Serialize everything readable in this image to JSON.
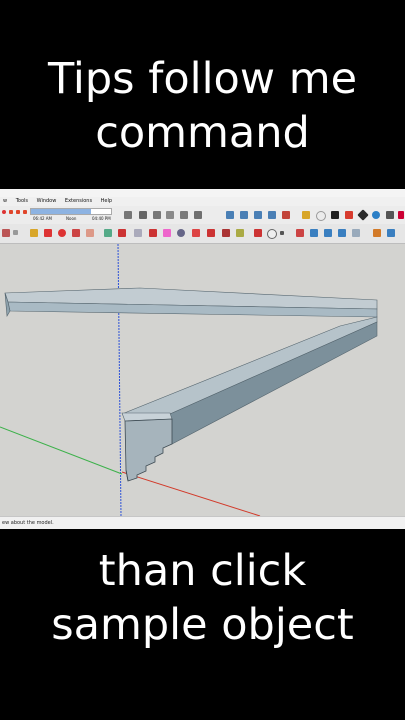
{
  "captions": {
    "top": [
      "Tips follow me",
      "command"
    ],
    "bottom": [
      "than click",
      "sample object"
    ]
  },
  "app": {
    "menu": [
      "w",
      "Tools",
      "Window",
      "Extensions",
      "Help"
    ],
    "shadow_times": {
      "left": "06:42 AM",
      "middle": "Noon",
      "right": "04:40 PM"
    },
    "status_text": "ew about the model."
  },
  "colors": {
    "background": "#000000",
    "viewport": "#d3d3d0",
    "model_top": "#c2ccd2",
    "model_side": "#93a8b4",
    "model_dark": "#6e818c",
    "axis_blue": "#2d52d8",
    "axis_green": "#3cb14a",
    "axis_red": "#d23a2a"
  }
}
